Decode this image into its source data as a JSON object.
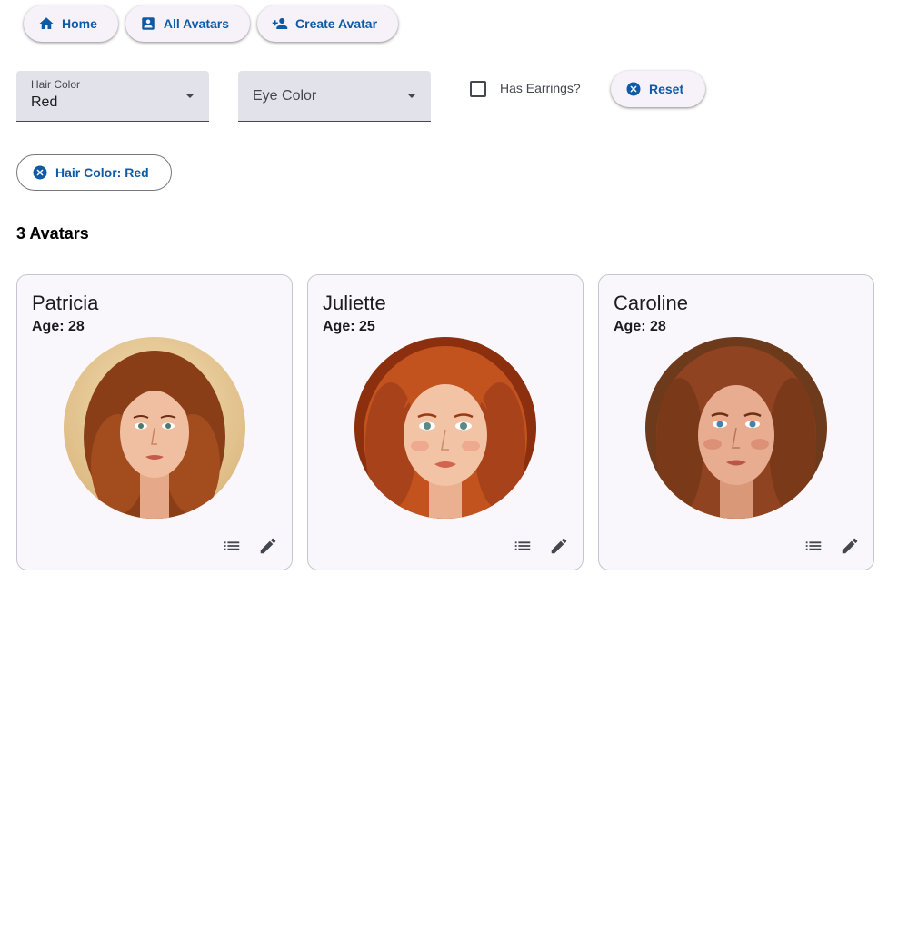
{
  "nav": {
    "home_label": "Home",
    "all_avatars_label": "All Avatars",
    "create_avatar_label": "Create Avatar"
  },
  "filters": {
    "hair_color": {
      "label": "Hair Color",
      "value": "Red"
    },
    "eye_color": {
      "label": "Eye Color",
      "value": ""
    },
    "earrings": {
      "label": "Has Earrings?",
      "checked": false
    },
    "reset_label": "Reset"
  },
  "active_chips": [
    {
      "label": "Hair Color: Red"
    }
  ],
  "results": {
    "count_label": "3 Avatars"
  },
  "avatars": [
    {
      "name": "Patricia",
      "age_label": "Age: 28",
      "icon": "portrait-image"
    },
    {
      "name": "Juliette",
      "age_label": "Age: 25",
      "icon": "portrait-image"
    },
    {
      "name": "Caroline",
      "age_label": "Age: 28",
      "icon": "portrait-image"
    }
  ],
  "colors": {
    "accent": "#0d5aa6",
    "surface": "#f7f2fa",
    "field": "#e2e3ea",
    "card": "#f9f7fb"
  },
  "icons": {
    "home": "home-icon",
    "all_avatars": "contact-card-icon",
    "create": "person-add-icon",
    "cancel": "cancel-circle-icon",
    "details": "list-icon",
    "edit": "pencil-icon"
  }
}
